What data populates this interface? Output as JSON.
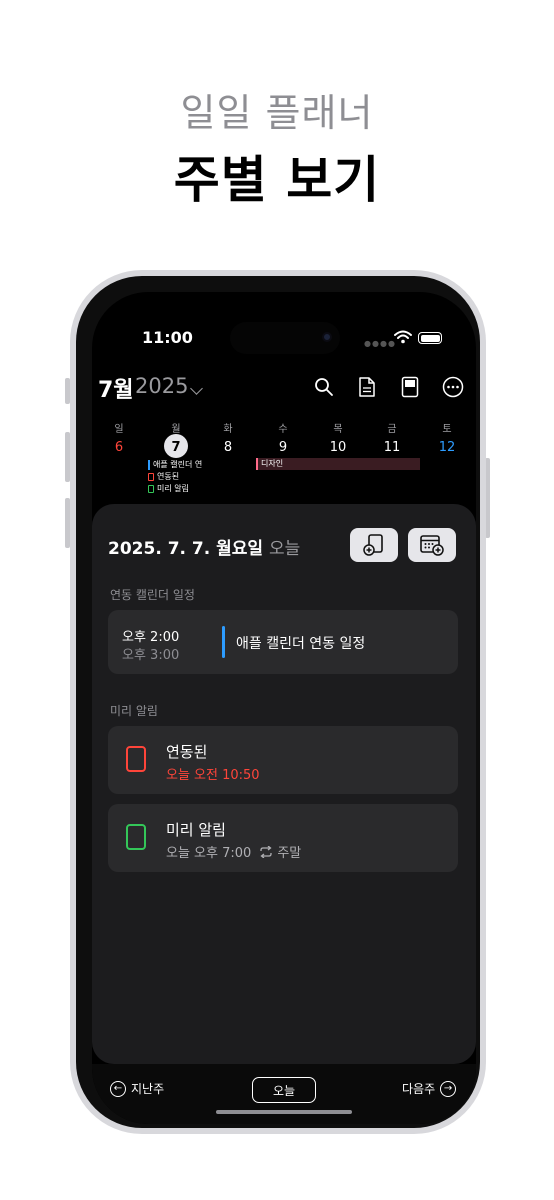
{
  "promo": {
    "subtitle": "일일 플래너",
    "title": "주별 보기"
  },
  "status_bar": {
    "time": "11:00"
  },
  "header": {
    "month": "7월",
    "year": "2025"
  },
  "week": {
    "weekdays": [
      "일",
      "월",
      "화",
      "수",
      "목",
      "금",
      "토"
    ],
    "dates": [
      "6",
      "7",
      "8",
      "9",
      "10",
      "11",
      "12"
    ],
    "monday_events": [
      "애플 캘린더 연",
      "연동된",
      "미리 알림"
    ],
    "multi_day_event": "디자인"
  },
  "day": {
    "date_label": "2025. 7. 7. 월요일",
    "today_label": "오늘"
  },
  "calendar_section": {
    "label": "연동 캘린더 일정",
    "event": {
      "start": "오후 2:00",
      "end": "오후 3:00",
      "title": "애플 캘린더 연동 일정"
    }
  },
  "reminder_section": {
    "label": "미리 알림",
    "items": [
      {
        "title": "연동된",
        "subtitle": "오늘 오전 10:50"
      },
      {
        "title": "미리 알림",
        "subtitle": "오늘 오후 7:00",
        "repeat": "주말"
      }
    ]
  },
  "bottom_nav": {
    "prev": "지난주",
    "today": "오늘",
    "next": "다음주"
  },
  "colors": {
    "sunday": "#ff453a",
    "saturday": "#2d9cff",
    "overdue": "#ff453a",
    "reminder_green": "#34c759"
  }
}
